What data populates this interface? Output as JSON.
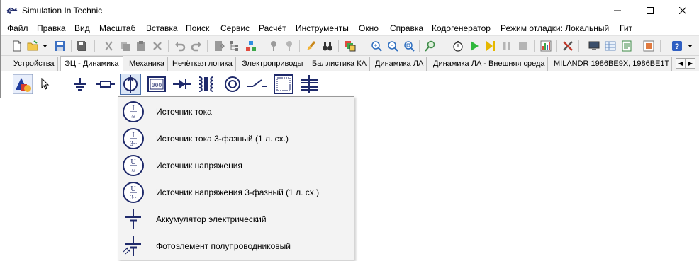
{
  "window": {
    "title": "Simulation In Technic"
  },
  "menu": [
    "Файл",
    "Правка",
    "Вид",
    "Масштаб",
    "Вставка",
    "Поиск",
    "Сервис",
    "Расчёт",
    "Инструменты",
    "Окно",
    "Справка",
    "Кодогенератор",
    "Режим отладки: Локальный",
    "Гит"
  ],
  "tabs": [
    "Устройства",
    "ЭЦ - Динамика",
    "Механика",
    "Нечёткая логика",
    "Электроприводы",
    "Баллистика КА",
    "Динамика ЛА",
    "Динамика ЛА - Внешняя среда",
    "MILANDR 1986BE9X, 1986BE1T"
  ],
  "active_tab_index": 1,
  "dropdown": {
    "items": [
      {
        "label": "Источник тока",
        "icon": "current-source-icon",
        "top": "I",
        "bottom": "≈"
      },
      {
        "label": "Источник тока 3-фазный (1 л. сх.)",
        "icon": "current-source-3phase-icon",
        "top": "I",
        "bottom": "3~"
      },
      {
        "label": "Источник напряжения",
        "icon": "voltage-source-icon",
        "top": "U",
        "bottom": "≈"
      },
      {
        "label": "Источник напряжения 3-фазный (1 л. сх.)",
        "icon": "voltage-source-3phase-icon",
        "top": "U",
        "bottom": "3~"
      },
      {
        "label": "Аккумулятор электрический",
        "icon": "battery-icon"
      },
      {
        "label": "Фотоэлемент полупроводниковый",
        "icon": "photocell-icon"
      }
    ]
  },
  "colors": {
    "icon_navy": "#1f2a6b",
    "selection": "#dbe6f6",
    "menu_bg": "#f3f3f3"
  }
}
